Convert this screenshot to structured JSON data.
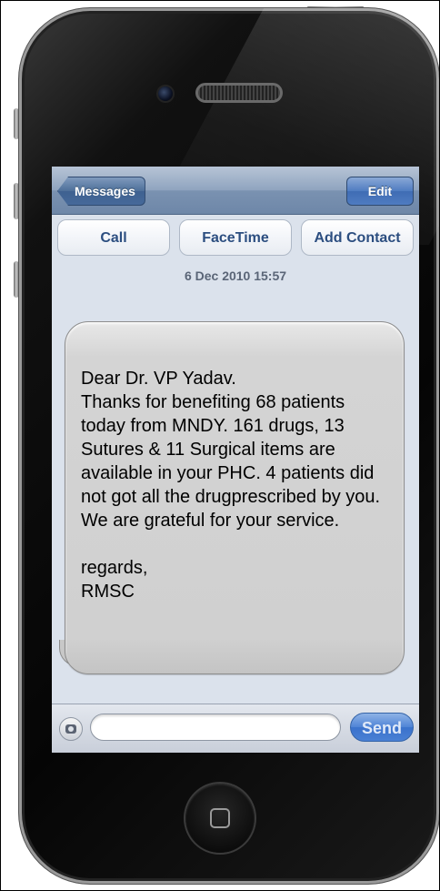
{
  "navbar": {
    "back_label": "Messages",
    "edit_label": "Edit"
  },
  "actions": {
    "call_label": "Call",
    "facetime_label": "FaceTime",
    "add_contact_label": "Add Contact"
  },
  "conversation": {
    "timestamp": "6 Dec 2010 15:57",
    "message": "Dear Dr. VP Yadav.\nThanks for benefiting 68 patients today from MNDY. 161 drugs, 13 Sutures & 11 Surgical items are available in your PHC. 4 patients did not got all the drugprescribed by you. We are grateful for your service.\n\nregards,\nRMSC"
  },
  "composer": {
    "input_value": "",
    "send_label": "Send"
  },
  "colors": {
    "navbar": "#7a92b1",
    "send_button": "#4a80d4",
    "bubble": "#d0d0d0"
  },
  "icons": {
    "camera": "camera-icon",
    "home": "home-button-icon"
  }
}
